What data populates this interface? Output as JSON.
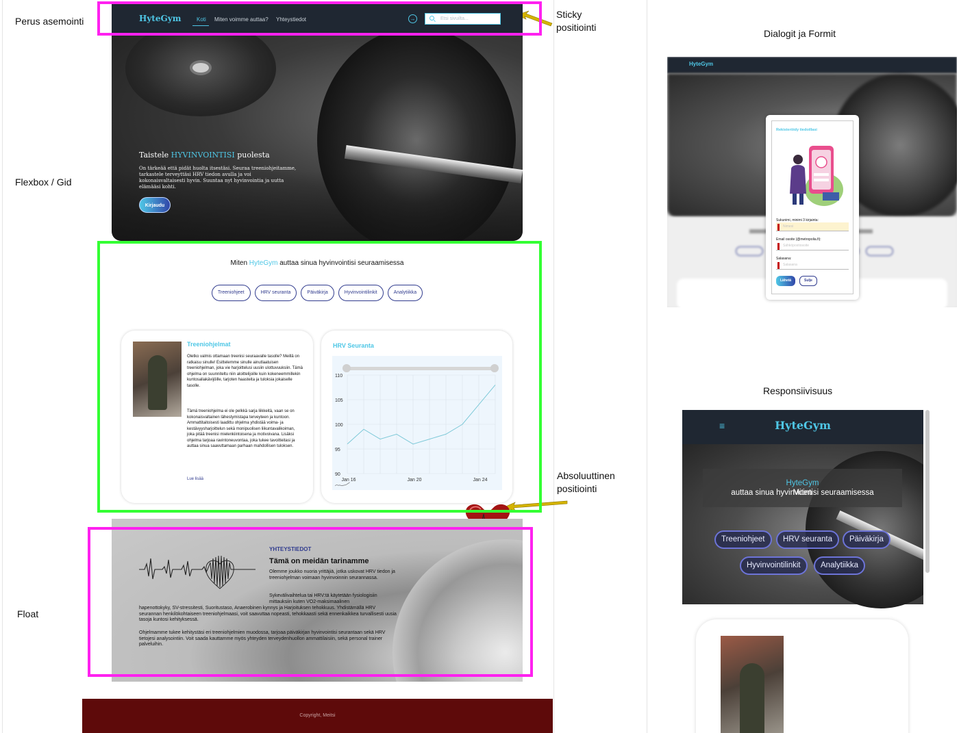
{
  "annotations": {
    "basic_positioning": "Perus asemointi",
    "flexbox_grid": "Flexbox / Gid",
    "float": "Float",
    "sticky": "Sticky\npositiointi",
    "absolute": "Absoluuttinen\npositiointi",
    "dialogs_forms": "Dialogit ja Formit",
    "responsive": "Responsiivisuus"
  },
  "colors": {
    "annotation_magenta": "#ff21f0",
    "annotation_green": "#33ff33",
    "arrow_yellow": "#d4b300",
    "brand_cyan": "#4fc7e6",
    "brand_navy": "#303b8e",
    "nav_bg": "#1f2732",
    "footer_bg": "#5e0a0a"
  },
  "nav": {
    "logo": "HyteGym",
    "links": [
      "Koti",
      "Miten voimme auttaa?",
      "Yhteystiedot"
    ],
    "active_link": "Koti",
    "login_icon": "login-icon",
    "search_placeholder": "Etsi sivuilta..."
  },
  "hero": {
    "title_prefix": "Taistele ",
    "title_highlight": "HYVINVOINTISI",
    "title_suffix": " puolesta",
    "text": "On tärkeää että pidät huolta itsestäsi. Seuraa treeniohjeitamme, tarkastele terveyttäsi HRV tiedon avulla ja voi kokonaisvaltaisesti hyvin. Suuntaa nyt hyvinvointia ja uutta elämääsi kohti.",
    "button": "Kirjaudu"
  },
  "services": {
    "title_prefix": "Miten ",
    "title_highlight": "HyteGym",
    "title_suffix": " auttaa sinua hyvinvointisi seuraamisessa",
    "pills": [
      "Treeniohjeet",
      "HRV seuranta",
      "Päiväkirja",
      "Hyvinvointilinkit",
      "Analytiikka"
    ]
  },
  "training_card": {
    "title": "Treeniohjelmat",
    "paragraph1": "Oletko valmis ottamaan treenisi seuraavalle tasolle? Meillä on ratkaisu sinulle! Esittelemme sinulle ainutlaatuisen treeniohjelman, joka vie harjoittelusi uusiin ulottuvuuksiin. Tämä ohjelma on suunniteltu niin aloittelijoille kuin kokeneemmillekin kuntosaliakävijöille, tarjoten haasteita ja tuloksia jokaiselle tasolle.",
    "paragraph2": "Tämä treeniohjelma ei ole pelkkä sarja liikkeitä, vaan se on kokonaisvaltainen lähestymistapa terveyteen ja kuntoon. Ammattitaitoisesti laadittu ohjelma yhdistää voima- ja kestävyysharjoittelun sekä monipuolisen liikuntavalikoiman, joka pitää treenisi mielenkiintoisena ja motivoivana. Lisäksi ohjelma tarjoaa ravintoneuvontaa, joka tukee tavoitteitasi ja auttaa sinua saavuttamaan parhaan mahdollisen tuloksen.",
    "read_more": "Lue lisää"
  },
  "hrv_card": {
    "title": "HRV Seuranta"
  },
  "chart_data": {
    "type": "line",
    "title": "HRV Seuranta",
    "xlabel": "",
    "ylabel": "",
    "x_ticks": [
      "Jan 16",
      "Jan 20",
      "Jan 24"
    ],
    "y_ticks": [
      90,
      95,
      100,
      105,
      110
    ],
    "ylim": [
      90,
      110
    ],
    "grid": true,
    "series": [
      {
        "x": [
          "Jan 16",
          "Jan 17",
          "Jan 18",
          "Jan 19",
          "Jan 20",
          "Jan 21",
          "Jan 22",
          "Jan 23",
          "Jan 24",
          "Jan 25"
        ],
        "values": [
          96,
          99,
          97,
          98,
          96,
          97,
          98,
          100,
          104,
          108
        ],
        "color": "#7ec9d8"
      }
    ]
  },
  "contact": {
    "section_label": "YHTEYSTIEDOT",
    "heading": "Tämä on meidän tarinamme",
    "p1": "Olemme joukko nuoria yrittäjiä, jotka uskovat HRV tiedon ja treeniohjelman voimaan hyvinvoinnin seurannassa.",
    "p2": "Sykevälivaihtelua tai HRV:tä käytetään fysiologisiin mittauksiin kuten VO2-maksimaalinen",
    "p3": "hapenottokyky, SV-stressitesti, Suoritustaso, Anaerobinen kynnys ja Harjoituksen tehokkuus. Yhdistämällä HRV seurannan henkilökohtaiseen treeniohjelmaasi, voit saavuttaa nopeasti, tehokkaasti sekä ennenkaikkea turvallisesti uusia tasoja kuntosi kehityksessä.",
    "p4": "Ohjelmamme tukee kehitystäsi eri treeniohjelmien muodossa, tarjoaa päiväkirjan hyvinvointisi seurantaan sekä HRV tietojesi analysointiin. Voit saada kauttamme myös yhteyden terveydenhuollon ammattilaisiin, sekä personal trainer palveluihin."
  },
  "footer": {
    "text": "Copyright, Meitsi"
  },
  "dialog_preview": {
    "logo": "HyteGym",
    "form_title": "Rekisteröidy tiedoillasi",
    "fields": [
      {
        "label": "Sukunimi, minimi 3 kirjainta:",
        "placeholder": "Nimesi"
      },
      {
        "label": "Email osoite (@metropolia.fi):",
        "placeholder": "Sähköpostiosoite"
      },
      {
        "label": "Salasana:",
        "placeholder": "Salasana"
      }
    ],
    "submit": "Lähetä",
    "close": "Sulje"
  },
  "responsive_preview": {
    "logo": "HyteGym",
    "menu_icon": "hamburger-menu-icon",
    "menu_glyph": "≡",
    "title_prefix": "Miten ",
    "title_highlight": "HyteGym",
    "title_suffix": " auttaa sinua hyvinvointisi seuraamisessa",
    "pills": [
      "Treeniohjeet",
      "HRV seuranta",
      "Päiväkirja",
      "Hyvinvointilinkit",
      "Analytiikka"
    ]
  }
}
